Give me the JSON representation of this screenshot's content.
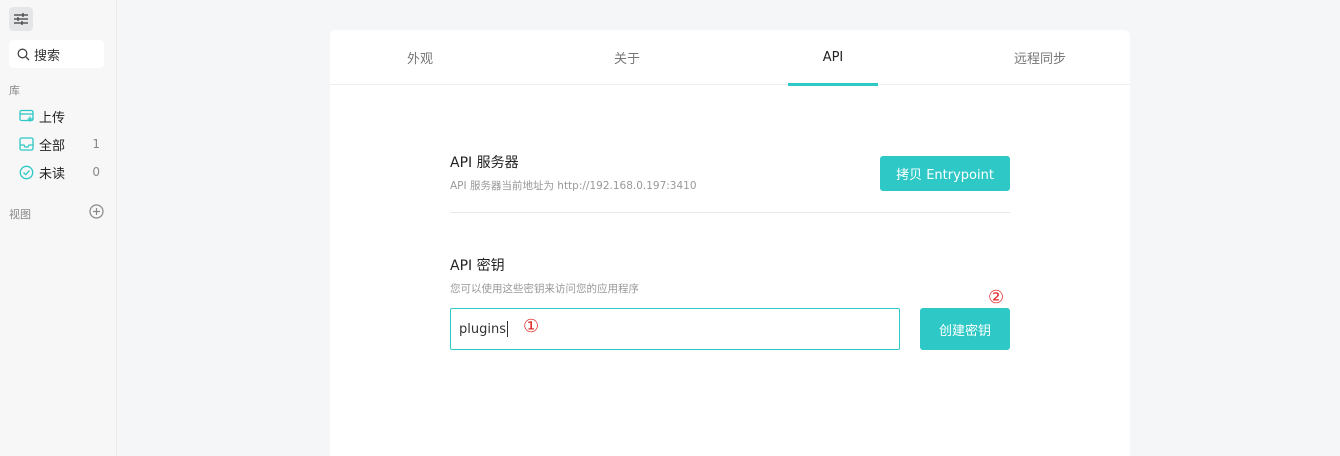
{
  "sidebar": {
    "settings_icon": "sliders-icon",
    "search_label": "搜索",
    "library_title": "库",
    "items": [
      {
        "label": "上传",
        "count": "",
        "icon": "upload-icon"
      },
      {
        "label": "全部",
        "count": "1",
        "icon": "inbox-icon"
      },
      {
        "label": "未读",
        "count": "0",
        "icon": "check-circle-icon"
      }
    ],
    "views_title": "视图"
  },
  "tabs": [
    "外观",
    "关于",
    "API",
    "远程同步"
  ],
  "active_tab": "API",
  "api_server": {
    "title": "API 服务器",
    "desc": "API 服务器当前地址为 http://192.168.0.197:3410",
    "copy_button": "拷贝 Entrypoint"
  },
  "api_key": {
    "title": "API 密钥",
    "desc": "您可以使用这些密钥来访问您的应用程序",
    "input_value": "plugins",
    "create_button": "创建密钥"
  },
  "annotations": {
    "marker1": "①",
    "marker2": "②"
  },
  "colors": {
    "accent": "#2ec8c6",
    "annotation": "#e32a2a"
  }
}
